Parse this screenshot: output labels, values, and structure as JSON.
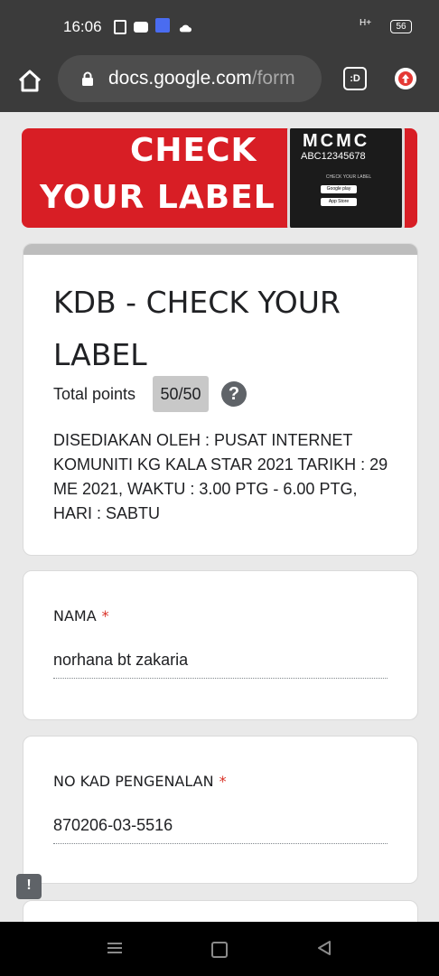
{
  "status_bar": {
    "time": "16:06",
    "signal": "H+",
    "battery": "56"
  },
  "browser": {
    "url_domain": "docs.google.com",
    "url_path": "/form",
    "tabs_label": ":D"
  },
  "banner": {
    "line1": "CHECK",
    "line2": "YOUR LABEL",
    "phone_brand": "MCMC",
    "phone_code": "ABC12345678",
    "phone_caption": "CHECK YOUR LABEL",
    "store1": "Google play",
    "store2": "App Store"
  },
  "form": {
    "title": "KDB - CHECK YOUR LABEL",
    "points_label": "Total points",
    "points_value": "50/50",
    "help_icon": "?",
    "description": "DISEDIAKAN OLEH : PUSAT INTERNET KOMUNITI KG KALA STAR 2021 TARIKH : 29 ME 2021, WAKTU : 3.00 PTG - 6.00 PTG, HARI : SABTU",
    "questions": [
      {
        "label": "NAMA",
        "required_mark": "*",
        "answer": "norhana bt zakaria"
      },
      {
        "label": "NO KAD PENGENALAN",
        "required_mark": "*",
        "answer": "870206-03-5516"
      }
    ]
  },
  "feedback_icon": "!"
}
